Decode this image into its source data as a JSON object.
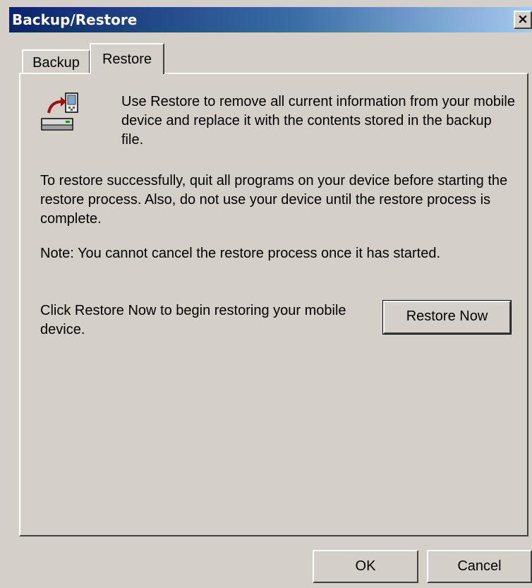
{
  "window": {
    "title": "Backup/Restore",
    "close_glyph": "×"
  },
  "tabs": [
    {
      "label": "Backup",
      "selected": false
    },
    {
      "label": "Restore",
      "selected": true
    }
  ],
  "restore_panel": {
    "icon": "restore-device-icon",
    "intro_text": "Use Restore to remove all current information from your mobile device and replace it with the contents stored in the backup file.",
    "warning_text": "To restore successfully, quit all programs on your device before starting the restore process. Also, do not use your device until the restore process is complete.",
    "note_text": "Note: You cannot cancel the restore process once it has started.",
    "click_instruction": "Click Restore Now to begin restoring your mobile device.",
    "restore_now_label": "Restore Now"
  },
  "footer": {
    "ok_label": "OK",
    "cancel_label": "Cancel"
  },
  "colors": {
    "face": "#d4d0c8",
    "titlebar_start": "#0a246a",
    "titlebar_end": "#a6caf0",
    "arrow": "#a01010"
  }
}
